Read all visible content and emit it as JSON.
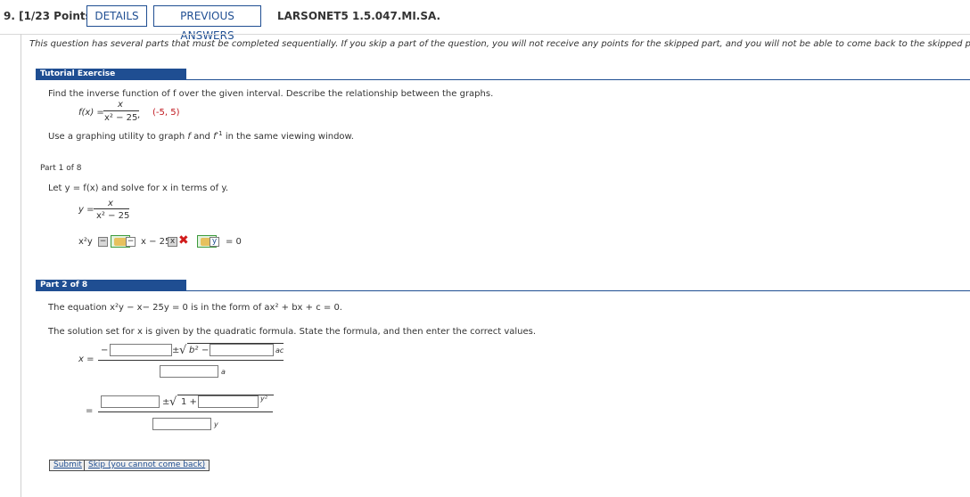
{
  "header": {
    "question_label": "9. [1/23 Points]",
    "details_button": "DETAILS",
    "previous_answers_button": "PREVIOUS ANSWERS",
    "problem_code": "LARSONET5 1.5.047.MI.SA."
  },
  "note": "This question has several parts that must be completed sequentially. If you skip a part of the question, you will not receive any points for the skipped part, and you will not be able to come back to the skipped part.",
  "tutorial": {
    "banner": "Tutorial Exercise",
    "instruction": "Find the inverse function of f over the given interval. Describe the relationship between the graphs.",
    "fx_label": "f(x) =",
    "numerator": "x",
    "denominator": "x² − 25",
    "comma": ",",
    "interval": "(-5, 5)",
    "graph_prefix": "Use a graphing utility to graph",
    "graph_f": "f",
    "graph_and": "and",
    "graph_finv": "f",
    "graph_inv_sup": "-1",
    "graph_suffix": "in the same viewing window."
  },
  "part1": {
    "label": "Part 1 of 8",
    "let_text": "Let y = f(x) and solve for x in terms of y.",
    "y_eq": "y =",
    "numerator": "x",
    "denominator": "x² − 25",
    "term_x2y": "x²y",
    "minus": "−",
    "term_x_minus_25": "x − 25",
    "tile_y": "y",
    "eq_zero": "= 0",
    "tile_minus": "−",
    "tile_x": "x",
    "x_mark": "✖"
  },
  "part2": {
    "label": "Part 2 of 8",
    "equation_text": "The equation x²y − x− 25y = 0 is in the form of ax² + bx + c = 0.",
    "solution_text": "The solution set for x is given by the quadratic formula. State the formula, and then enter the correct values.",
    "x_eq": "x =",
    "minus_sign": "−",
    "plus_minus": "±",
    "b_squared": "b²",
    "minus": "−",
    "ac": "ac",
    "a": "a",
    "equals": "=",
    "one_plus": "1 +",
    "y_squared": "y²",
    "y": "y"
  },
  "actions": {
    "submit": "Submit",
    "skip": "Skip (you cannot come back)"
  },
  "colors": {
    "accent": "#1f4e92",
    "error": "#d11b1b",
    "interval_red": "#c0181f"
  }
}
